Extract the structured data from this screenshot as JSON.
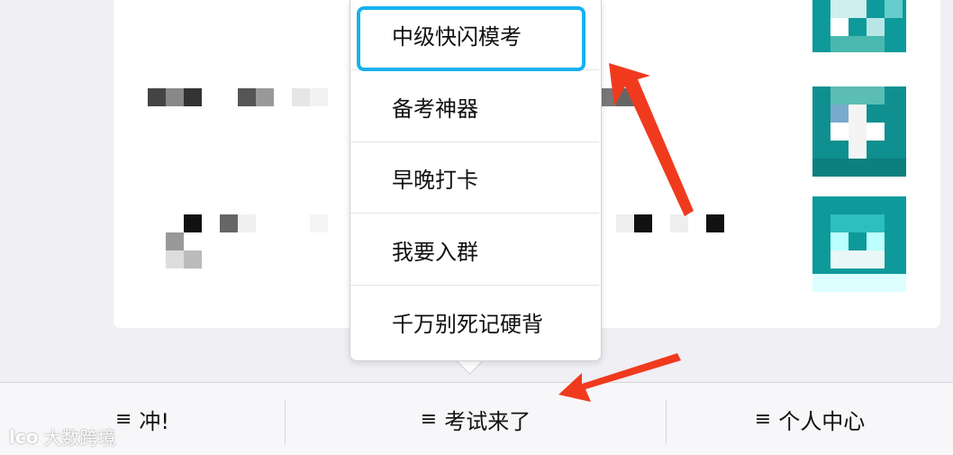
{
  "popup_menu": {
    "items": [
      {
        "label": "中级快闪模考"
      },
      {
        "label": "备考神器"
      },
      {
        "label": "早晚打卡"
      },
      {
        "label": "我要入群"
      },
      {
        "label": "千万别死记硬背"
      }
    ],
    "highlighted_index": 0
  },
  "tab_bar": {
    "tabs": [
      {
        "icon": "≡",
        "label": "冲!"
      },
      {
        "icon": "≡",
        "label": "考试来了"
      },
      {
        "icon": "≡",
        "label": "个人中心"
      }
    ]
  },
  "watermark": {
    "mark": "lco",
    "text": "大数跨境"
  },
  "colors": {
    "highlight": "#17b0f0",
    "annotation_arrow": "#f03a1e",
    "mosaic_teal": "#0e9a9a"
  }
}
